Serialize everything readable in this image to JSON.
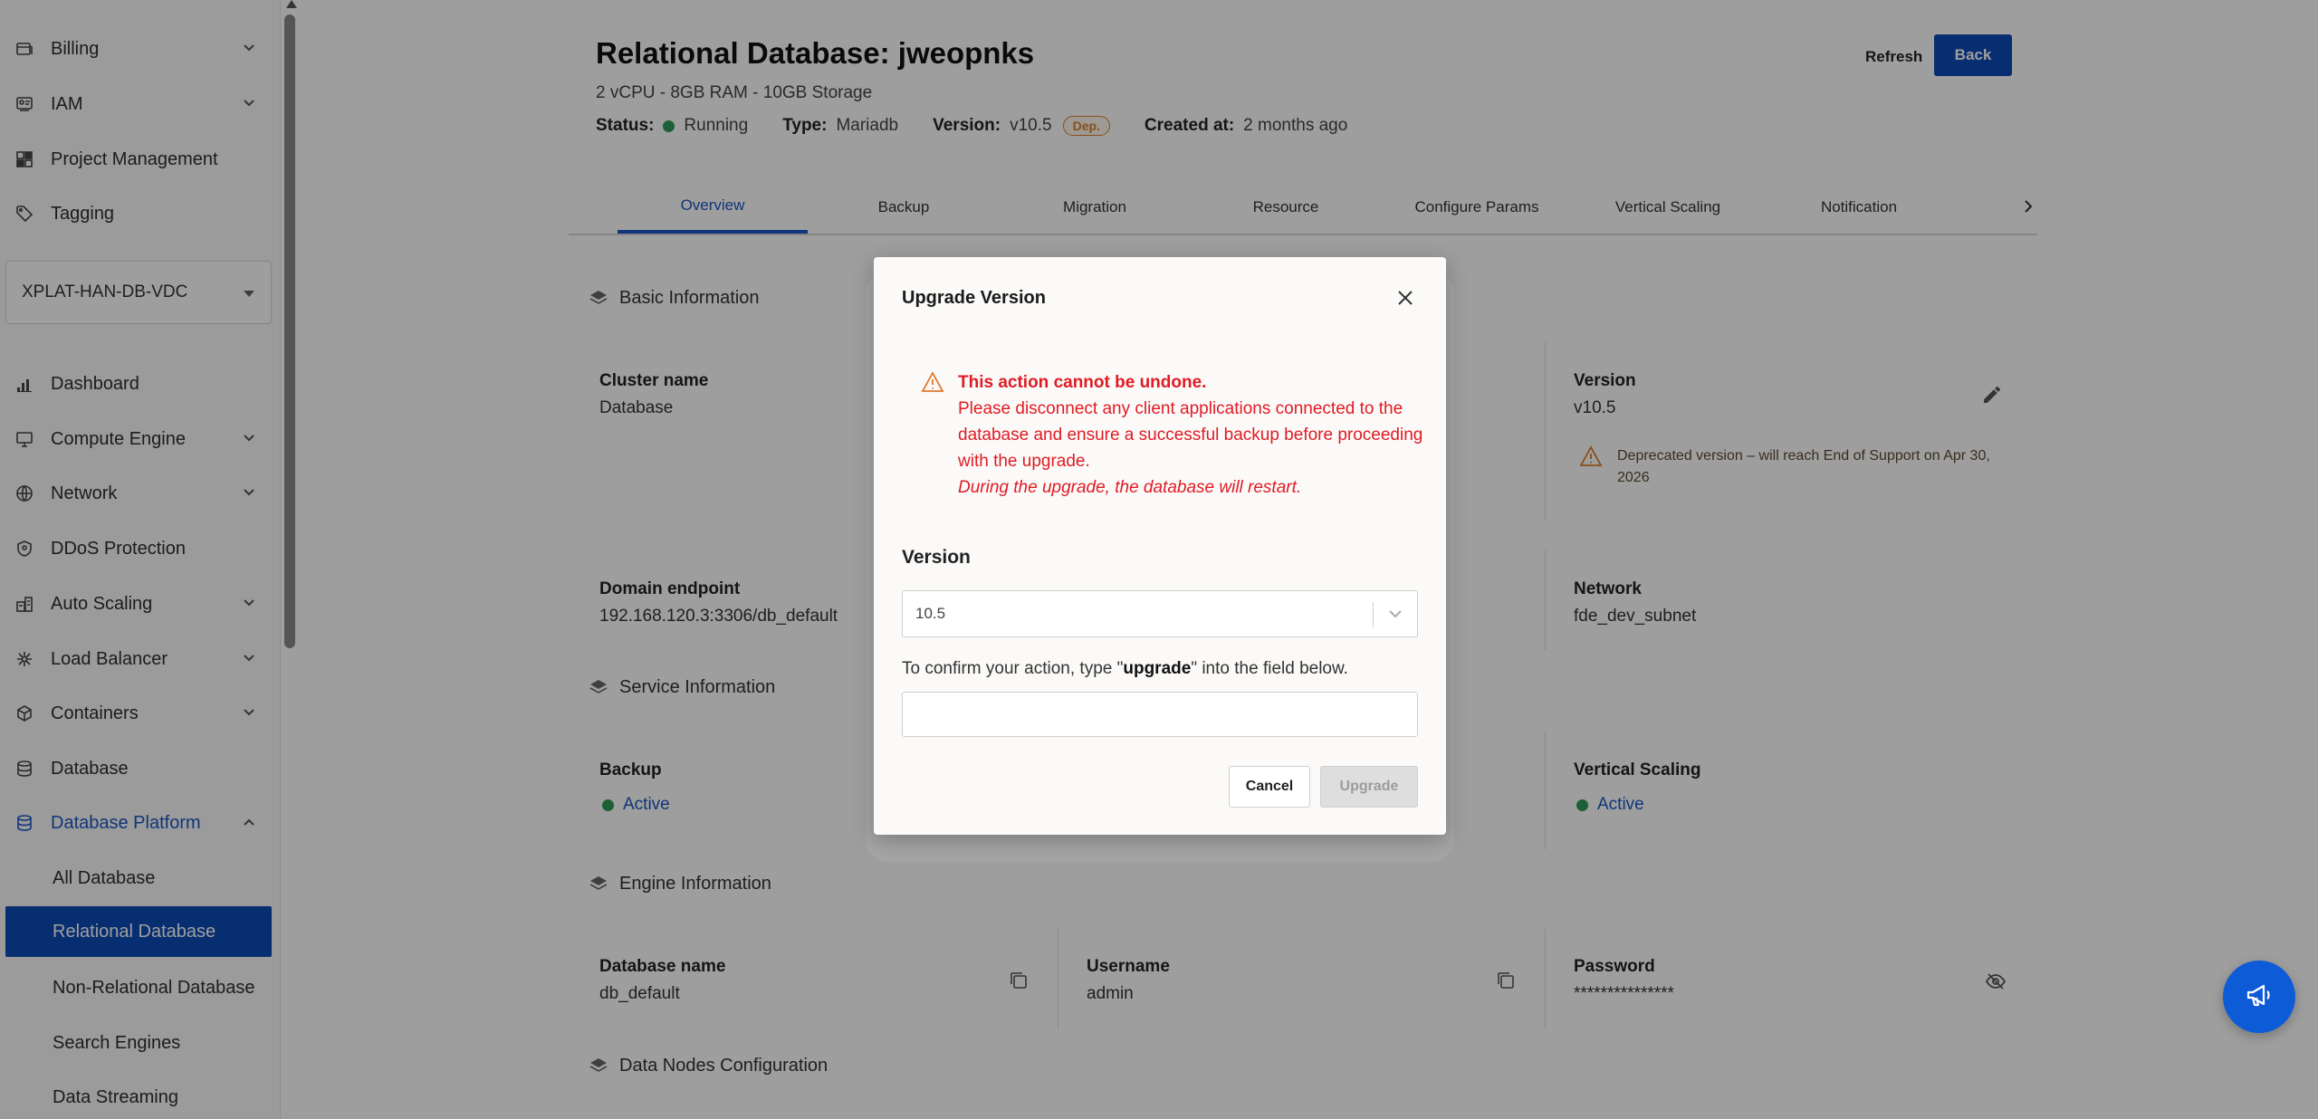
{
  "sidebar": {
    "items": [
      {
        "label": "Billing"
      },
      {
        "label": "IAM"
      },
      {
        "label": "Project Management"
      },
      {
        "label": "Tagging"
      },
      {
        "label": "Dashboard"
      },
      {
        "label": "Compute Engine"
      },
      {
        "label": "Network"
      },
      {
        "label": "DDoS Protection"
      },
      {
        "label": "Auto Scaling"
      },
      {
        "label": "Load Balancer"
      },
      {
        "label": "Containers"
      },
      {
        "label": "Database"
      },
      {
        "label": "Database Platform"
      }
    ],
    "project": "XPLAT-HAN-DB-VDC",
    "sub_items": [
      {
        "label": "All Database"
      },
      {
        "label": "Relational Database"
      },
      {
        "label": "Non-Relational Database"
      },
      {
        "label": "Search Engines"
      },
      {
        "label": "Data Streaming"
      }
    ]
  },
  "header": {
    "title": "Relational Database: jweopnks",
    "specs": "2 vCPU - 8GB RAM - 10GB Storage",
    "status_label": "Status:",
    "status_value": "Running",
    "type_label": "Type:",
    "type_value": "Mariadb",
    "version_label": "Version:",
    "version_value": "v10.5",
    "dep_badge": "Dep.",
    "created_label": "Created at:",
    "created_value": "2 months ago",
    "refresh_label": "Refresh",
    "back_label": "Back"
  },
  "tabs": [
    "Overview",
    "Backup",
    "Migration",
    "Resource",
    "Configure Params",
    "Vertical Scaling",
    "Notification"
  ],
  "sections": {
    "basic": "Basic Information",
    "service": "Service Information",
    "engine": "Engine Information",
    "nodes": "Data Nodes Configuration"
  },
  "fields": {
    "cluster_name_label": "Cluster name",
    "cluster_name_value": "Database",
    "version_label": "Version",
    "version_value": "v10.5",
    "deprecation_warning": "Deprecated version – will reach End of Support on Apr 30, 2026",
    "domain_label": "Domain endpoint",
    "domain_value": "192.168.120.3:3306/db_default",
    "network_label": "Network",
    "network_value": "fde_dev_subnet",
    "backup_label": "Backup",
    "backup_value": "Active",
    "vscaling_label": "Vertical Scaling",
    "vscaling_value": "Active",
    "dbname_label": "Database name",
    "dbname_value": "db_default",
    "username_label": "Username",
    "username_value": "admin",
    "password_label": "Password",
    "password_value": "***************"
  },
  "modal": {
    "title": "Upgrade Version",
    "alert_title": "This action cannot be undone.",
    "alert_body": "Please disconnect any client applications connected to the database and ensure a successful backup before proceeding with the upgrade.",
    "alert_note": "During the upgrade, the database will restart.",
    "version_heading": "Version",
    "version_selected": "10.5",
    "confirm_prefix": "To confirm your action, type \"",
    "confirm_keyword": "upgrade",
    "confirm_suffix": "\" into the field below.",
    "confirm_value": "",
    "cancel_label": "Cancel",
    "upgrade_label": "Upgrade"
  },
  "colors": {
    "primary": "#0c4bb5",
    "accent_link": "#1a56c4",
    "danger": "#e01b24",
    "warning": "#d9822b",
    "success": "#2f9a58"
  }
}
